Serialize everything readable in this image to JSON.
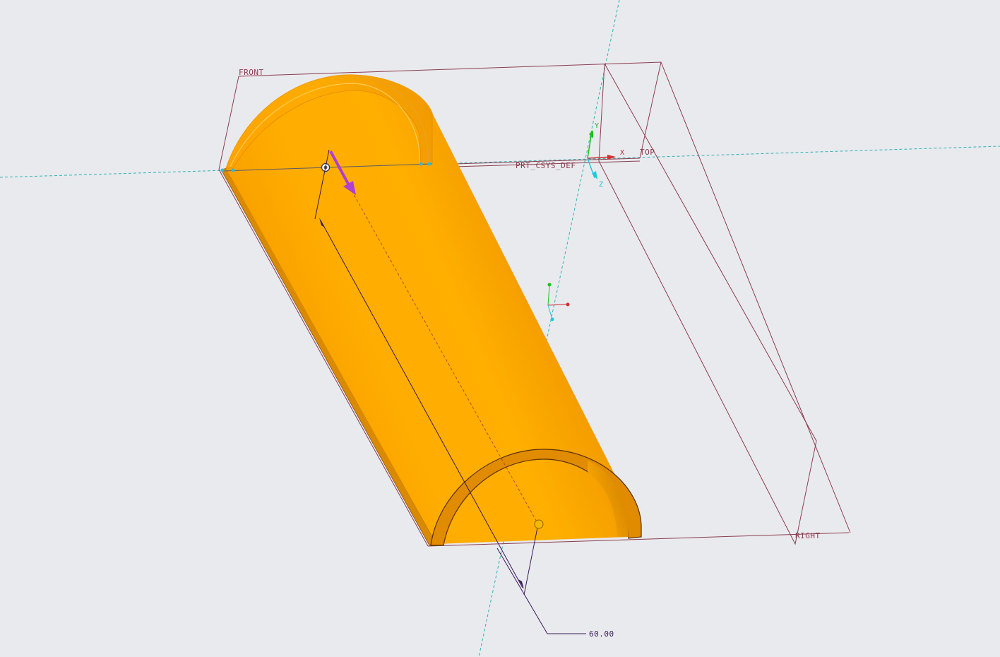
{
  "datum_planes": {
    "front": "FRONT",
    "top": "TOP",
    "right": "RIGHT"
  },
  "csys": {
    "name": "PRT_CSYS_DEF",
    "axis_x": "X",
    "axis_y": "Y",
    "axis_z": "Z"
  },
  "dimension": {
    "value": "60.00"
  },
  "colors": {
    "background": "#e9eaee",
    "part": "#ffab00",
    "datum_plane": "#8a3e4e",
    "datum_axis": "#2fb3b3",
    "dimension": "#3a1a5a",
    "drag_arrow": "#b040d0",
    "handle": "#f5b800"
  }
}
